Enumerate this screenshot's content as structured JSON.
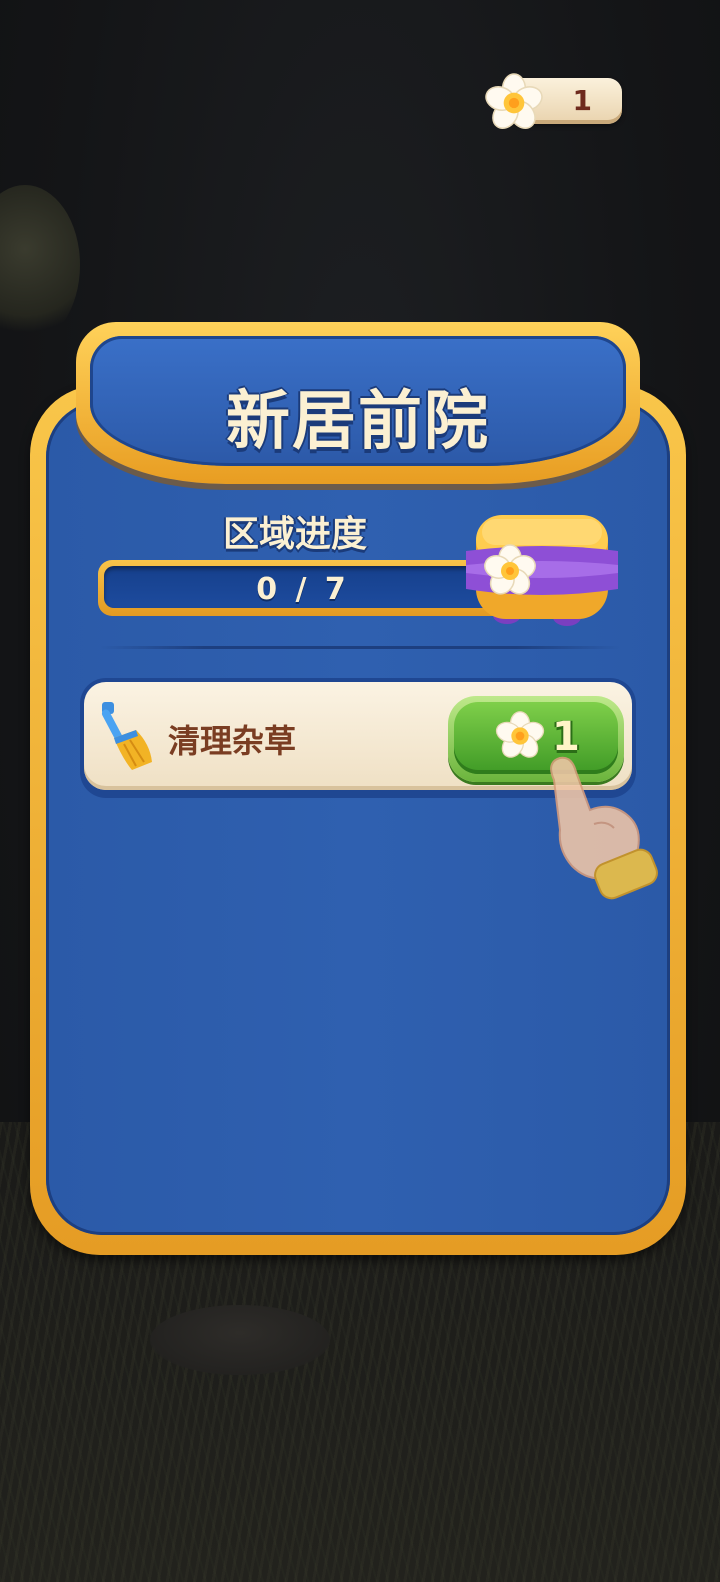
{
  "currency": {
    "value": "1",
    "icon": "flower-icon"
  },
  "panel": {
    "title": "新居前院",
    "progress": {
      "label": "区域进度",
      "text": "0 / 7",
      "current": 0,
      "total": 7,
      "reward_icon": "treasure-chest-icon"
    },
    "tasks": [
      {
        "label": "清理杂草",
        "icon": "broom-icon",
        "cost": "1",
        "cost_icon": "flower-icon"
      }
    ]
  },
  "tutorial_hint": "pointing-hand-icon",
  "colors": {
    "panel_blue": "#2f60b0",
    "frame_gold": "#f2b23a",
    "button_green": "#5cb534",
    "title_text": "#fbf0d2",
    "task_text": "#7a3d22"
  }
}
